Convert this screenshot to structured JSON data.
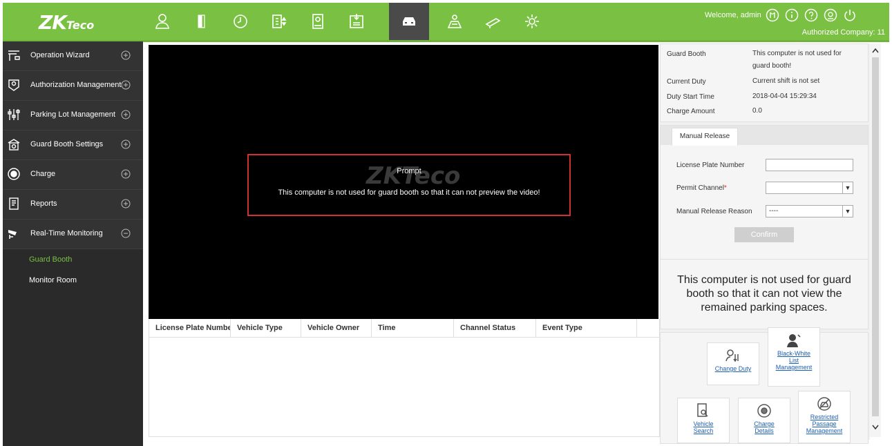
{
  "header": {
    "logo_main": "ZK",
    "logo_sub": "Teco",
    "welcome": "Welcome, admin",
    "authorized": "Authorized Company: 11",
    "nav_icons": [
      "personnel-icon",
      "access-icon",
      "attendance-icon",
      "elevator-icon",
      "visitor-icon",
      "consumption-icon",
      "parking-icon",
      "patrol-icon",
      "system-icon",
      "settings-icon"
    ],
    "active_nav": "parking-icon",
    "accent": "#7ac143"
  },
  "sidebar": {
    "items": [
      {
        "label": "Operation Wizard"
      },
      {
        "label": "Authorization Management"
      },
      {
        "label": "Parking Lot Management"
      },
      {
        "label": "Guard Booth Settings"
      },
      {
        "label": "Charge"
      },
      {
        "label": "Reports"
      },
      {
        "label": "Real-Time Monitoring"
      }
    ],
    "subitems": [
      {
        "label": "Guard Booth"
      },
      {
        "label": "Monitor Room"
      }
    ]
  },
  "video": {
    "watermark": "ZKTeco",
    "prompt_title": "Prompt",
    "prompt_msg": "This computer is not used for guard booth so that it can not preview the video!"
  },
  "table": {
    "headers": [
      "License Plate Number",
      "Vehicle Type",
      "Vehicle Owner",
      "Time",
      "Channel Status",
      "Event Type"
    ]
  },
  "info": {
    "guard_booth_label": "Guard Booth",
    "guard_booth_value": "This computer is not used for guard booth!",
    "duty_label": "Current Duty",
    "duty_value": "Current shift is not set",
    "start_label": "Duty Start Time",
    "start_value": "2018-04-04 15:29:34",
    "charge_label": "Charge Amount",
    "charge_value": "0.0"
  },
  "manual_release": {
    "tab": "Manual Release",
    "plate_label": "License Plate Number",
    "plate_value": "",
    "channel_label": "Permit Channel",
    "channel_required": "*",
    "channel_value": "",
    "reason_label": "Manual Release Reason",
    "reason_value": "----",
    "confirm": "Confirm"
  },
  "spaces_msg": "This computer is not used for guard booth so that it can not view the remained parking spaces.",
  "actions": {
    "change_duty": "Change Duty",
    "bw_list_1": "Black-White",
    "bw_list_2": "List",
    "bw_list_3": "Management",
    "vehicle_search_1": "Vehicle",
    "vehicle_search_2": "Search",
    "charge_details_1": "Charge",
    "charge_details_2": "Details",
    "restricted_1": "Restricted",
    "restricted_2": "Passage",
    "restricted_3": "Management"
  }
}
